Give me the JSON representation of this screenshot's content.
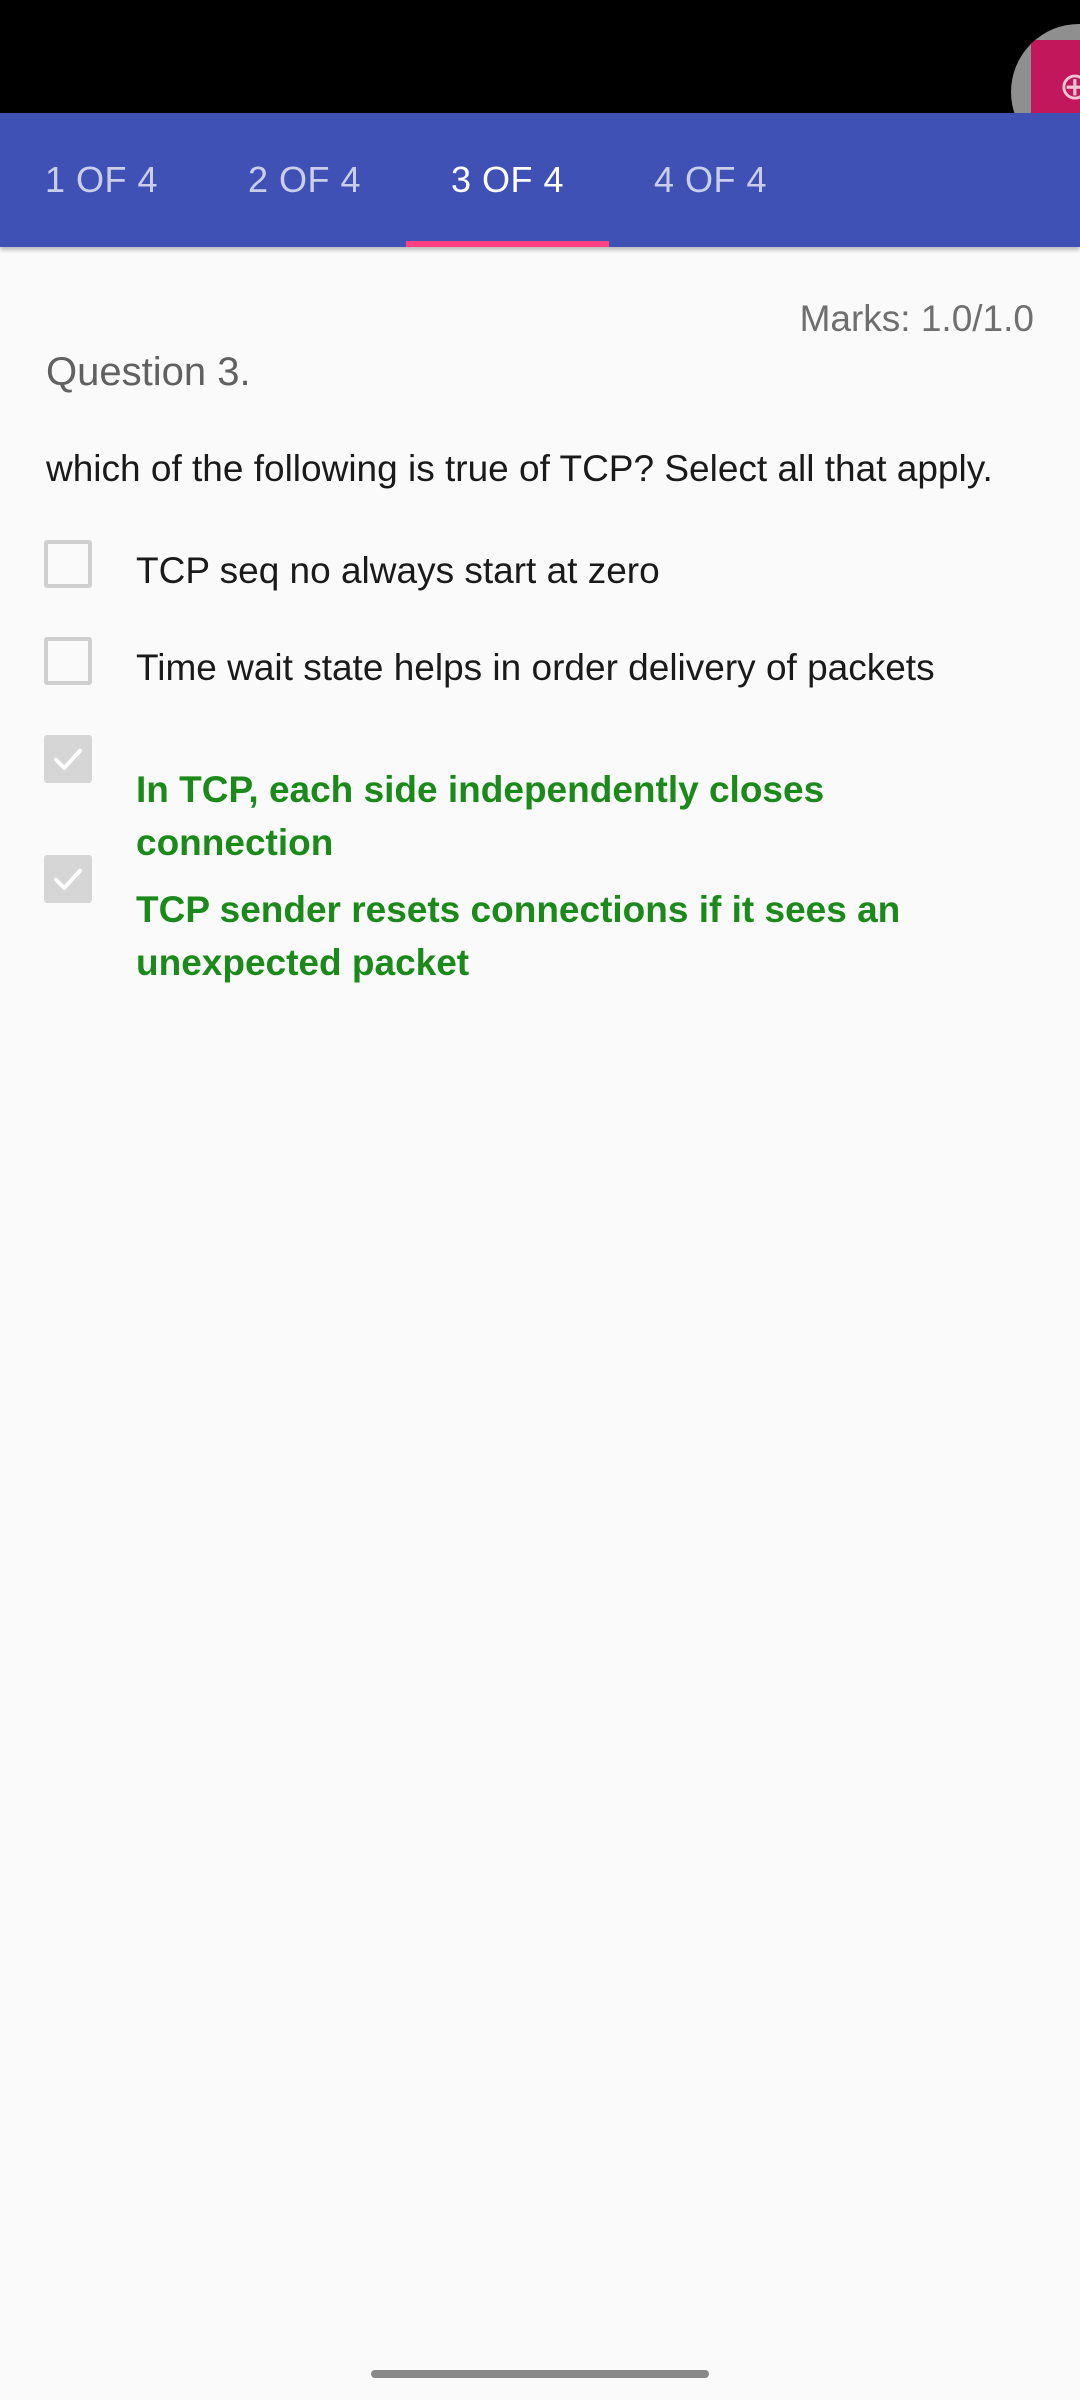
{
  "tabs": [
    {
      "label": "1 OF 4",
      "active": false
    },
    {
      "label": "2 OF 4",
      "active": false
    },
    {
      "label": "3 OF 4",
      "active": true
    },
    {
      "label": "4 OF 4",
      "active": false
    }
  ],
  "question": {
    "marks": "Marks: 1.0/1.0",
    "title": "Question 3.",
    "text": "which of the following is true of TCP? Select all that apply."
  },
  "options": [
    {
      "label": "TCP seq no always start at zero",
      "checked": false,
      "correct": false
    },
    {
      "label": "Time wait state helps in order delivery of packets",
      "checked": false,
      "correct": false
    },
    {
      "label": "In TCP, each side independently closes connection",
      "checked": true,
      "correct": true
    },
    {
      "label": "TCP sender resets connections if it sees an unexpected packet",
      "checked": true,
      "correct": true
    }
  ],
  "colors": {
    "tab_bar": "#3f51b5",
    "tab_indicator": "#ff4081",
    "correct_answer": "#1b8a1b",
    "floating_bubble": "#c2185b"
  },
  "icons": {
    "floating_bubble": "floating-bubble-icon",
    "checkbox_checked": "check-icon"
  }
}
